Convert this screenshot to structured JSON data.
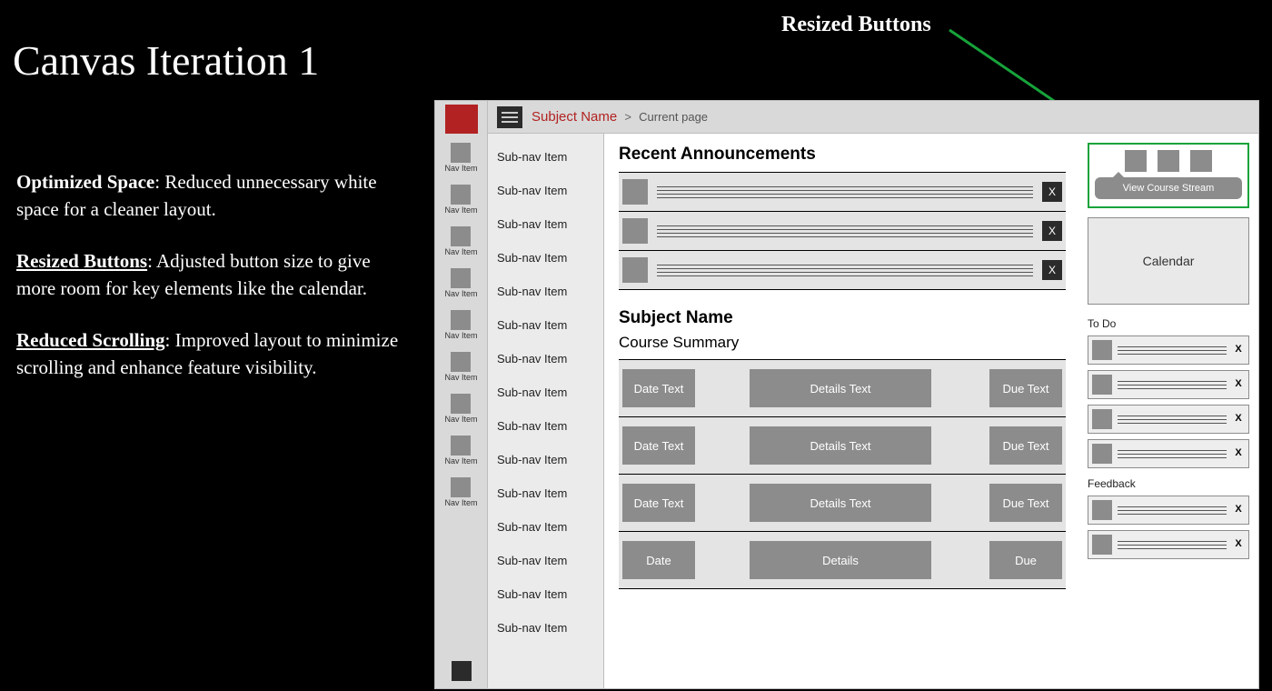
{
  "slide": {
    "title": "Canvas Iteration 1",
    "callout": "Resized Buttons",
    "bullets": [
      {
        "key": "Optimized Space",
        "text": ": Reduced unnecessary white space for a cleaner layout.",
        "underline": false
      },
      {
        "key": "Resized Buttons",
        "text": ": Adjusted button size to give more room for key elements like the calendar.",
        "underline": true
      },
      {
        "key": "Reduced Scrolling",
        "text": ": Improved layout to minimize scrolling and enhance feature visibility.",
        "underline": true
      }
    ]
  },
  "colors": {
    "accent_red": "#b22222",
    "highlight_green": "#17a33a"
  },
  "breadcrumb": {
    "subject": "Subject Name",
    "sep": ">",
    "current": "Current page"
  },
  "rail": {
    "items": [
      "Nav Item",
      "Nav Item",
      "Nav Item",
      "Nav Item",
      "Nav Item",
      "Nav Item",
      "Nav Item",
      "Nav Item",
      "Nav Item"
    ]
  },
  "subnav": {
    "items": [
      "Sub-nav Item",
      "Sub-nav Item",
      "Sub-nav Item",
      "Sub-nav Item",
      "Sub-nav Item",
      "Sub-nav Item",
      "Sub-nav Item",
      "Sub-nav Item",
      "Sub-nav Item",
      "Sub-nav Item",
      "Sub-nav Item",
      "Sub-nav Item",
      "Sub-nav Item",
      "Sub-nav Item",
      "Sub-nav Item"
    ]
  },
  "main": {
    "announcements_heading": "Recent Announcements",
    "announcements_count": 3,
    "close_label": "X",
    "subject_heading": "Subject Name",
    "course_summary_heading": "Course Summary",
    "summary_rows": [
      {
        "date": "Date Text",
        "details": "Details Text",
        "due": "Due Text"
      },
      {
        "date": "Date Text",
        "details": "Details Text",
        "due": "Due Text"
      },
      {
        "date": "Date Text",
        "details": "Details Text",
        "due": "Due Text"
      },
      {
        "date": "Date",
        "details": "Details",
        "due": "Due"
      }
    ]
  },
  "aside": {
    "view_course_stream": "View Course Stream",
    "calendar_label": "Calendar",
    "todo_heading": "To Do",
    "todo_count": 4,
    "feedback_heading": "Feedback",
    "feedback_count": 2,
    "mini_close": "X"
  }
}
